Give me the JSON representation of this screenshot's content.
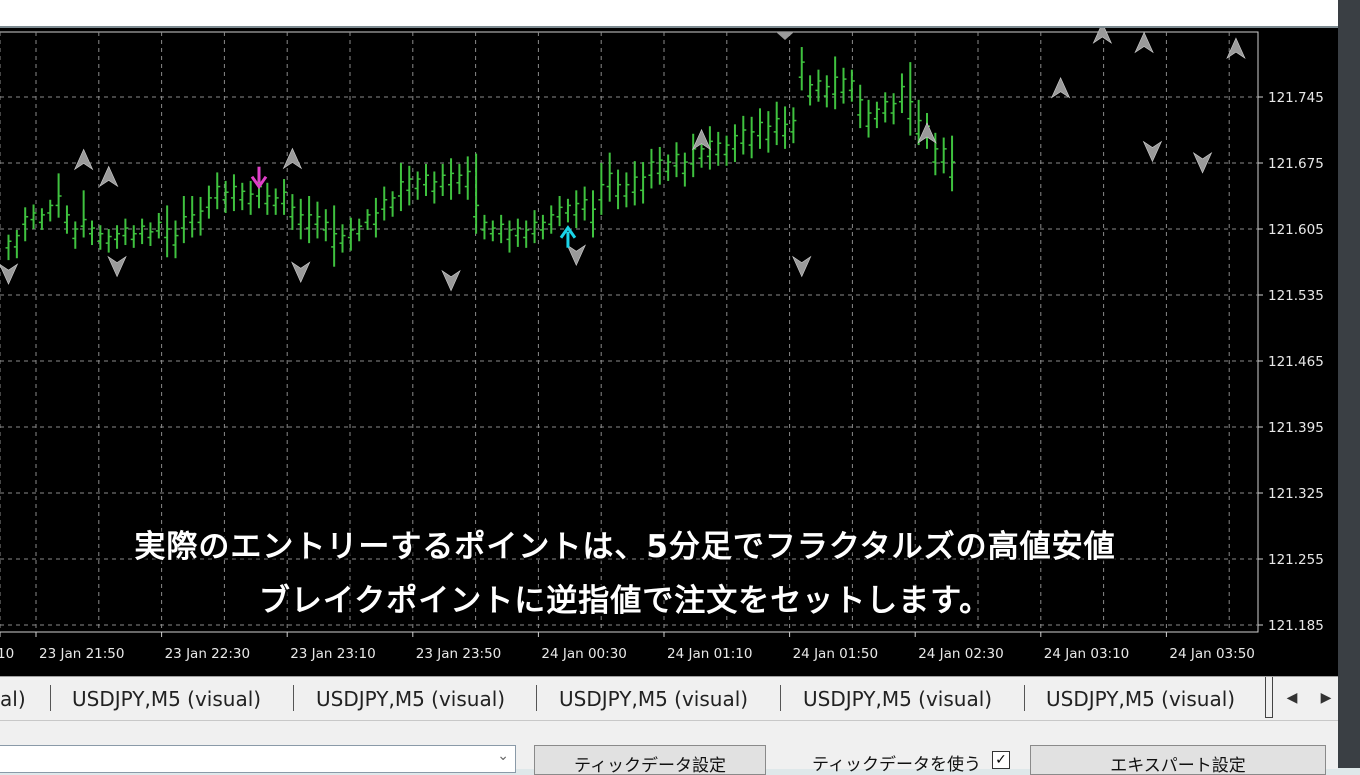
{
  "chart": {
    "price_labels": [
      "121.745",
      "121.675",
      "121.605",
      "121.535",
      "121.465",
      "121.395",
      "121.325",
      "121.255",
      "121.185"
    ],
    "time_labels": [
      "10",
      "23 Jan 21:50",
      "23 Jan 22:30",
      "23 Jan 23:10",
      "23 Jan 23:50",
      "24 Jan 00:30",
      "24 Jan 01:10",
      "24 Jan 01:50",
      "24 Jan 02:30",
      "24 Jan 03:10",
      "24 Jan 03:50"
    ],
    "colors": {
      "background": "#000000",
      "bars": "#3fc23f",
      "grid": "#8a8a8a",
      "buy_arrow": "#19d4e8",
      "sell_arrow": "#e040c8",
      "fractal": "#9a9a9a"
    },
    "bars": [
      {
        "h": 121.599,
        "l": 121.572,
        "o": 121.585,
        "c": 121.592
      },
      {
        "h": 121.604,
        "l": 121.574,
        "o": 121.586,
        "c": 121.598
      },
      {
        "h": 121.628,
        "l": 121.592,
        "o": 121.61,
        "c": 121.618
      },
      {
        "h": 121.631,
        "l": 121.605,
        "o": 121.615,
        "c": 121.622
      },
      {
        "h": 121.627,
        "l": 121.604,
        "o": 121.612,
        "c": 121.62
      },
      {
        "h": 121.636,
        "l": 121.613,
        "o": 121.622,
        "c": 121.63
      },
      {
        "h": 121.664,
        "l": 121.617,
        "o": 121.63,
        "c": 121.64
      },
      {
        "h": 121.63,
        "l": 121.6,
        "o": 121.612,
        "c": 121.62
      },
      {
        "h": 121.613,
        "l": 121.584,
        "o": 121.595,
        "c": 121.605
      },
      {
        "h": 121.646,
        "l": 121.596,
        "o": 121.608,
        "c": 121.615
      },
      {
        "h": 121.614,
        "l": 121.588,
        "o": 121.6,
        "c": 121.606
      },
      {
        "h": 121.609,
        "l": 121.583,
        "o": 121.592,
        "c": 121.6
      },
      {
        "h": 121.605,
        "l": 121.58,
        "o": 121.59,
        "c": 121.597
      },
      {
        "h": 121.609,
        "l": 121.584,
        "o": 121.594,
        "c": 121.6
      },
      {
        "h": 121.616,
        "l": 121.588,
        "o": 121.598,
        "c": 121.606
      },
      {
        "h": 121.609,
        "l": 121.585,
        "o": 121.594,
        "c": 121.6
      },
      {
        "h": 121.616,
        "l": 121.589,
        "o": 121.6,
        "c": 121.608
      },
      {
        "h": 121.612,
        "l": 121.587,
        "o": 121.596,
        "c": 121.602
      },
      {
        "h": 121.622,
        "l": 121.595,
        "o": 121.603,
        "c": 121.612
      },
      {
        "h": 121.63,
        "l": 121.575,
        "o": 121.596,
        "c": 121.605
      },
      {
        "h": 121.614,
        "l": 121.574,
        "o": 121.588,
        "c": 121.598
      },
      {
        "h": 121.64,
        "l": 121.59,
        "o": 121.606,
        "c": 121.618
      },
      {
        "h": 121.64,
        "l": 121.596,
        "o": 121.612,
        "c": 121.62
      },
      {
        "h": 121.639,
        "l": 121.598,
        "o": 121.612,
        "c": 121.624
      },
      {
        "h": 121.651,
        "l": 121.616,
        "o": 121.628,
        "c": 121.638
      },
      {
        "h": 121.665,
        "l": 121.626,
        "o": 121.638,
        "c": 121.65
      },
      {
        "h": 121.656,
        "l": 121.622,
        "o": 121.636,
        "c": 121.644
      },
      {
        "h": 121.663,
        "l": 121.624,
        "o": 121.638,
        "c": 121.65
      },
      {
        "h": 121.654,
        "l": 121.625,
        "o": 121.636,
        "c": 121.645
      },
      {
        "h": 121.656,
        "l": 121.62,
        "o": 121.632,
        "c": 121.642
      },
      {
        "h": 121.662,
        "l": 121.627,
        "o": 121.64,
        "c": 121.65
      },
      {
        "h": 121.654,
        "l": 121.62,
        "o": 121.632,
        "c": 121.64
      },
      {
        "h": 121.648,
        "l": 121.62,
        "o": 121.63,
        "c": 121.638
      },
      {
        "h": 121.658,
        "l": 121.62,
        "o": 121.632,
        "c": 121.644
      },
      {
        "h": 121.642,
        "l": 121.604,
        "o": 121.618,
        "c": 121.628
      },
      {
        "h": 121.637,
        "l": 121.594,
        "o": 121.61,
        "c": 121.62
      },
      {
        "h": 121.64,
        "l": 121.59,
        "o": 121.606,
        "c": 121.62
      },
      {
        "h": 121.634,
        "l": 121.595,
        "o": 121.61,
        "c": 121.618
      },
      {
        "h": 121.626,
        "l": 121.592,
        "o": 121.604,
        "c": 121.612
      },
      {
        "h": 121.63,
        "l": 121.565,
        "o": 121.586,
        "c": 121.6
      },
      {
        "h": 121.61,
        "l": 121.58,
        "o": 121.59,
        "c": 121.598
      },
      {
        "h": 121.617,
        "l": 121.582,
        "o": 121.596,
        "c": 121.604
      },
      {
        "h": 121.616,
        "l": 121.592,
        "o": 121.6,
        "c": 121.608
      },
      {
        "h": 121.626,
        "l": 121.604,
        "o": 121.612,
        "c": 121.62
      },
      {
        "h": 121.638,
        "l": 121.596,
        "o": 121.61,
        "c": 121.622
      },
      {
        "h": 121.65,
        "l": 121.614,
        "o": 121.626,
        "c": 121.636
      },
      {
        "h": 121.645,
        "l": 121.618,
        "o": 121.628,
        "c": 121.638
      },
      {
        "h": 121.675,
        "l": 121.624,
        "o": 121.64,
        "c": 121.655
      },
      {
        "h": 121.672,
        "l": 121.63,
        "o": 121.646,
        "c": 121.658
      },
      {
        "h": 121.666,
        "l": 121.636,
        "o": 121.648,
        "c": 121.658
      },
      {
        "h": 121.674,
        "l": 121.64,
        "o": 121.652,
        "c": 121.662
      },
      {
        "h": 121.666,
        "l": 121.632,
        "o": 121.645,
        "c": 121.655
      },
      {
        "h": 121.674,
        "l": 121.64,
        "o": 121.65,
        "c": 121.662
      },
      {
        "h": 121.68,
        "l": 121.636,
        "o": 121.652,
        "c": 121.664
      },
      {
        "h": 121.674,
        "l": 121.642,
        "o": 121.654,
        "c": 121.662
      },
      {
        "h": 121.682,
        "l": 121.636,
        "o": 121.65,
        "c": 121.666
      },
      {
        "h": 121.685,
        "l": 121.6,
        "o": 121.618,
        "c": 121.63
      },
      {
        "h": 121.62,
        "l": 121.594,
        "o": 121.604,
        "c": 121.612
      },
      {
        "h": 121.614,
        "l": 121.592,
        "o": 121.6,
        "c": 121.606
      },
      {
        "h": 121.62,
        "l": 121.59,
        "o": 121.6,
        "c": 121.61
      },
      {
        "h": 121.614,
        "l": 121.58,
        "o": 121.594,
        "c": 121.604
      },
      {
        "h": 121.616,
        "l": 121.586,
        "o": 121.598,
        "c": 121.606
      },
      {
        "h": 121.614,
        "l": 121.585,
        "o": 121.596,
        "c": 121.604
      },
      {
        "h": 121.625,
        "l": 121.59,
        "o": 121.6,
        "c": 121.612
      },
      {
        "h": 121.62,
        "l": 121.594,
        "o": 121.604,
        "c": 121.612
      },
      {
        "h": 121.63,
        "l": 121.6,
        "o": 121.61,
        "c": 121.62
      },
      {
        "h": 121.64,
        "l": 121.608,
        "o": 121.618,
        "c": 121.628
      },
      {
        "h": 121.637,
        "l": 121.612,
        "o": 121.622,
        "c": 121.63
      },
      {
        "h": 121.646,
        "l": 121.606,
        "o": 121.62,
        "c": 121.632
      },
      {
        "h": 121.65,
        "l": 121.614,
        "o": 121.626,
        "c": 121.636
      },
      {
        "h": 121.646,
        "l": 121.596,
        "o": 121.612,
        "c": 121.626
      },
      {
        "h": 121.675,
        "l": 121.62,
        "o": 121.636,
        "c": 121.652
      },
      {
        "h": 121.686,
        "l": 121.634,
        "o": 121.65,
        "c": 121.664
      },
      {
        "h": 121.668,
        "l": 121.626,
        "o": 121.64,
        "c": 121.652
      },
      {
        "h": 121.665,
        "l": 121.628,
        "o": 121.64,
        "c": 121.652
      },
      {
        "h": 121.677,
        "l": 121.63,
        "o": 121.644,
        "c": 121.66
      },
      {
        "h": 121.676,
        "l": 121.632,
        "o": 121.646,
        "c": 121.66
      },
      {
        "h": 121.69,
        "l": 121.648,
        "o": 121.662,
        "c": 121.676
      },
      {
        "h": 121.692,
        "l": 121.652,
        "o": 121.664,
        "c": 121.678
      },
      {
        "h": 121.684,
        "l": 121.656,
        "o": 121.666,
        "c": 121.676
      },
      {
        "h": 121.697,
        "l": 121.66,
        "o": 121.672,
        "c": 121.684
      },
      {
        "h": 121.686,
        "l": 121.65,
        "o": 121.664,
        "c": 121.676
      },
      {
        "h": 121.706,
        "l": 121.66,
        "o": 121.674,
        "c": 121.69
      },
      {
        "h": 121.7,
        "l": 121.67,
        "o": 121.68,
        "c": 121.69
      },
      {
        "h": 121.714,
        "l": 121.668,
        "o": 121.682,
        "c": 121.698
      },
      {
        "h": 121.708,
        "l": 121.672,
        "o": 121.684,
        "c": 121.696
      },
      {
        "h": 121.704,
        "l": 121.672,
        "o": 121.684,
        "c": 121.694
      },
      {
        "h": 121.716,
        "l": 121.676,
        "o": 121.69,
        "c": 121.704
      },
      {
        "h": 121.725,
        "l": 121.684,
        "o": 121.696,
        "c": 121.71
      },
      {
        "h": 121.724,
        "l": 121.68,
        "o": 121.694,
        "c": 121.708
      },
      {
        "h": 121.733,
        "l": 121.69,
        "o": 121.704,
        "c": 121.718
      },
      {
        "h": 121.73,
        "l": 121.686,
        "o": 121.7,
        "c": 121.714
      },
      {
        "h": 121.74,
        "l": 121.694,
        "o": 121.708,
        "c": 121.722
      },
      {
        "h": 121.735,
        "l": 121.69,
        "o": 121.704,
        "c": 121.716
      },
      {
        "h": 121.734,
        "l": 121.696,
        "o": 121.708,
        "c": 121.72
      },
      {
        "h": 121.798,
        "l": 121.752,
        "o": 121.766,
        "c": 121.782
      },
      {
        "h": 121.768,
        "l": 121.736,
        "o": 121.746,
        "c": 121.758
      },
      {
        "h": 121.774,
        "l": 121.74,
        "o": 121.752,
        "c": 121.762
      },
      {
        "h": 121.768,
        "l": 121.734,
        "o": 121.746,
        "c": 121.756
      },
      {
        "h": 121.788,
        "l": 121.732,
        "o": 121.748,
        "c": 121.766
      },
      {
        "h": 121.776,
        "l": 121.738,
        "o": 121.75,
        "c": 121.764
      },
      {
        "h": 121.774,
        "l": 121.74,
        "o": 121.752,
        "c": 121.762
      },
      {
        "h": 121.758,
        "l": 121.712,
        "o": 121.726,
        "c": 121.742
      },
      {
        "h": 121.742,
        "l": 121.702,
        "o": 121.714,
        "c": 121.728
      },
      {
        "h": 121.74,
        "l": 121.712,
        "o": 121.722,
        "c": 121.732
      },
      {
        "h": 121.75,
        "l": 121.718,
        "o": 121.728,
        "c": 121.74
      },
      {
        "h": 121.749,
        "l": 121.716,
        "o": 121.728,
        "c": 121.738
      },
      {
        "h": 121.77,
        "l": 121.728,
        "o": 121.74,
        "c": 121.756
      },
      {
        "h": 121.782,
        "l": 121.704,
        "o": 121.722,
        "c": 121.74
      },
      {
        "h": 121.742,
        "l": 121.694,
        "o": 121.706,
        "c": 121.72
      },
      {
        "h": 121.728,
        "l": 121.69,
        "o": 121.702,
        "c": 121.714
      },
      {
        "h": 121.707,
        "l": 121.662,
        "o": 121.676,
        "c": 121.69
      },
      {
        "h": 121.702,
        "l": 121.664,
        "o": 121.676,
        "c": 121.69
      },
      {
        "h": 121.704,
        "l": 121.645,
        "o": 121.66,
        "c": 121.676
      }
    ],
    "fractals": [
      {
        "bar": 0,
        "dir": "down",
        "price": 121.572
      },
      {
        "bar": 9,
        "dir": "up",
        "price": 121.664
      },
      {
        "bar": 12,
        "dir": "up",
        "price": 121.646
      },
      {
        "bar": 13,
        "dir": "down",
        "price": 121.58
      },
      {
        "bar": 34,
        "dir": "up",
        "price": 121.665
      },
      {
        "bar": 35,
        "dir": "down",
        "price": 121.574
      },
      {
        "bar": 53,
        "dir": "down",
        "price": 121.565
      },
      {
        "bar": 68,
        "dir": "down",
        "price": 121.592
      },
      {
        "bar": 83,
        "dir": "up",
        "price": 121.685
      },
      {
        "bar": 95,
        "dir": "down",
        "price": 121.58
      },
      {
        "bar": 110,
        "dir": "up",
        "price": 121.692
      },
      {
        "bar": 126,
        "dir": "up",
        "price": 121.74
      },
      {
        "bar": 131,
        "dir": "up",
        "price": 121.798
      },
      {
        "bar": 136,
        "dir": "up",
        "price": 121.788
      },
      {
        "bar": 137,
        "dir": "down",
        "price": 121.702
      },
      {
        "bar": 143,
        "dir": "down",
        "price": 121.69
      },
      {
        "bar": 147,
        "dir": "up",
        "price": 121.782
      }
    ],
    "signals": [
      {
        "bar": 30,
        "dir": "sell",
        "price": 121.652
      },
      {
        "bar": 67,
        "dir": "buy",
        "price": 121.6
      }
    ]
  },
  "caption": {
    "line1": "実際のエントリーするポイントは、5分足でフラクタルズの高値安値",
    "line2": "ブレイクポイントに逆指値で注文をセットします。"
  },
  "tabs": [
    {
      "label": "al)"
    },
    {
      "label": "USDJPY,M5 (visual)"
    },
    {
      "label": "USDJPY,M5 (visual)"
    },
    {
      "label": "USDJPY,M5 (visual)"
    },
    {
      "label": "USDJPY,M5 (visual)"
    },
    {
      "label": "USDJPY,M5 (visual)"
    }
  ],
  "tab_nav": {
    "prev_icon": "◀",
    "next_icon": "▶"
  },
  "bottom": {
    "combo_arrow_icon": "chevron-down-icon",
    "tick_settings_label": "ティックデータ設定",
    "use_tick_label": "ティックデータを使う",
    "use_tick_checked": true,
    "expert_settings_label": "エキスパート設定"
  }
}
